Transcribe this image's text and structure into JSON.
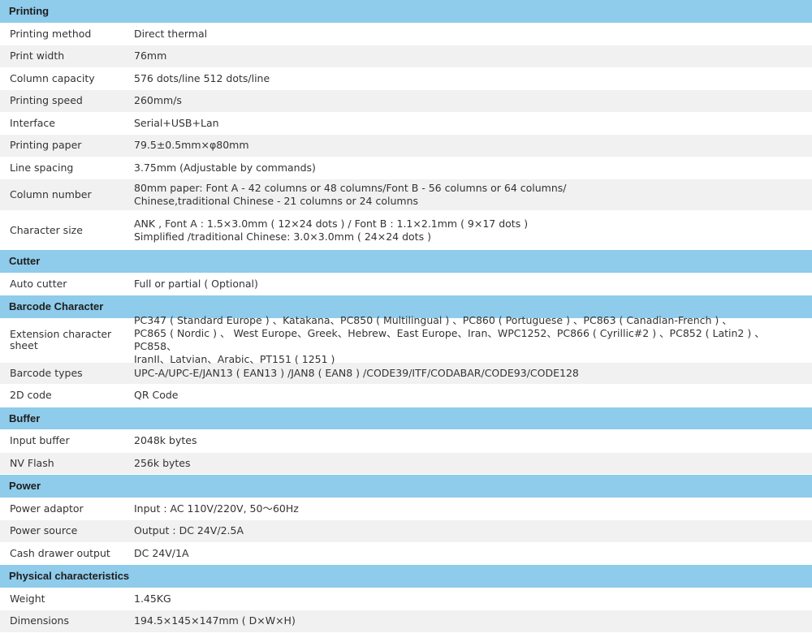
{
  "sections": [
    {
      "title": "Printing",
      "rows": [
        {
          "label": "Printing method",
          "value": "Direct thermal"
        },
        {
          "label": "Print width",
          "value": "76mm"
        },
        {
          "label": "Column capacity",
          "value": "576 dots/line 512 dots/line"
        },
        {
          "label": "Printing speed",
          "value": "260mm/s"
        },
        {
          "label": "Interface",
          "value": "Serial+USB+Lan"
        },
        {
          "label": "Printing paper",
          "value": "79.5±0.5mm×φ80mm"
        },
        {
          "label": "Line spacing",
          "value": "3.75mm (Adjustable by commands)"
        },
        {
          "label": "Column number",
          "value": "80mm paper: Font A - 42 columns or 48 columns/Font B - 56 columns or 64 columns/\nChinese,traditional Chinese - 21 columns or 24 columns"
        },
        {
          "label": "Character size",
          "value": "ANK , Font A : 1.5×3.0mm ( 12×24 dots )  / Font B : 1.1×2.1mm ( 9×17 dots )\nSimplified /traditional Chinese: 3.0×3.0mm ( 24×24 dots )"
        }
      ]
    },
    {
      "title": "Cutter",
      "rows": [
        {
          "label": "Auto cutter",
          "value": "Full or partial ( Optional)"
        }
      ]
    },
    {
      "title": "Barcode Character",
      "rows": [
        {
          "label": "Extension character sheet",
          "value": "PC347 ( Standard Europe ) 、Katakana、PC850 ( Multilingual ) 、PC860 ( Portuguese ) 、PC863 ( Canadian-French ) 、\nPC865 ( Nordic ) 、 West Europe、Greek、Hebrew、East Europe、Iran、WPC1252、PC866 ( Cyrillic#2 ) 、PC852 ( Latin2 ) 、PC858、\nIranII、Latvian、Arabic、PT151 ( 1251 )"
        },
        {
          "label": "Barcode types",
          "value": "UPC-A/UPC-E/JAN13 ( EAN13 ) /JAN8 ( EAN8 ) /CODE39/ITF/CODABAR/CODE93/CODE128"
        },
        {
          "label": "2D code",
          "value": "QR Code"
        }
      ]
    },
    {
      "title": "Buffer",
      "rows": [
        {
          "label": "Input buffer",
          "value": "2048k bytes"
        },
        {
          "label": "NV Flash",
          "value": "256k bytes"
        }
      ]
    },
    {
      "title": "Power",
      "rows": [
        {
          "label": "Power adaptor",
          "value": "Input : AC 110V/220V, 50～60Hz"
        },
        {
          "label": "Power source",
          "value": "Output : DC 24V/2.5A"
        },
        {
          "label": "Cash drawer output",
          "value": "DC 24V/1A"
        }
      ]
    },
    {
      "title": "Physical characteristics",
      "rows": [
        {
          "label": "Weight",
          "value": "1.45KG"
        },
        {
          "label": "Dimensions",
          "value": "194.5×145×147mm ( D×W×H)"
        }
      ]
    }
  ]
}
